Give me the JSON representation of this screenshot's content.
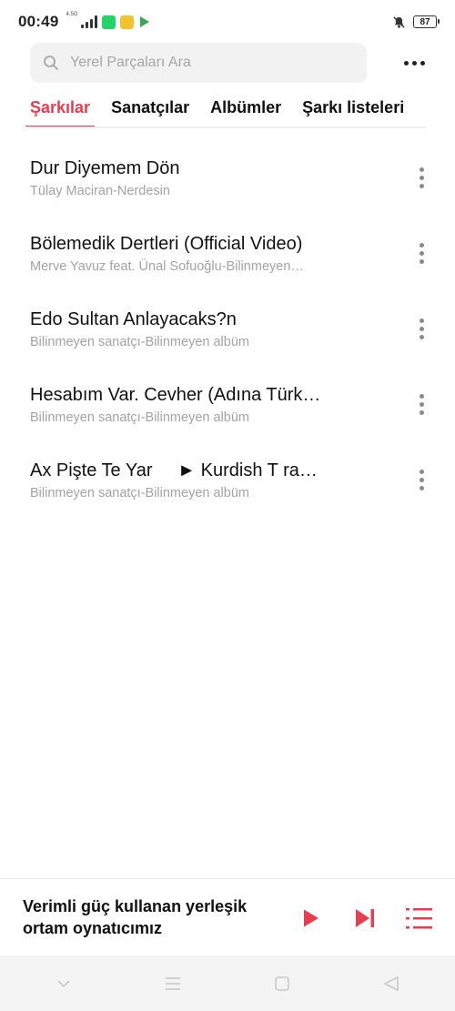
{
  "status": {
    "time": "00:49",
    "network": "4.5G",
    "battery": "87"
  },
  "search": {
    "placeholder": "Yerel Parçaları Ara"
  },
  "tabs": [
    {
      "label": "Şarkılar",
      "active": true
    },
    {
      "label": "Sanatçılar",
      "active": false
    },
    {
      "label": "Albümler",
      "active": false
    },
    {
      "label": "Şarkı listeleri",
      "active": false
    }
  ],
  "songs": [
    {
      "title": "Dur Diyemem Dön",
      "subtitle": "Tülay Maciran-Nerdesin"
    },
    {
      "title": "Bölemedik Dertleri (Official Video)",
      "subtitle": "Merve Yavuz feat. Ünal Sofuoğlu-Bilinmeyen…"
    },
    {
      "title": "Edo Sultan Anlayacaks?n",
      "subtitle": "Bilinmeyen sanatçı-Bilinmeyen albüm"
    },
    {
      "title": "Hesabım Var. Cevher (Adına Türk…",
      "subtitle": "Bilinmeyen sanatçı-Bilinmeyen albüm"
    },
    {
      "title": "Ax Pişte Te Yar     ► Kurdish T ra…",
      "subtitle": "Bilinmeyen sanatçı-Bilinmeyen albüm"
    }
  ],
  "player": {
    "text": "Verimli güç kullanan yerleşik ortam oynatıcımız"
  },
  "colors": {
    "accent": "#e63d4f",
    "secondary_text": "#a3a3a3"
  },
  "icons": {
    "search": "search-icon",
    "more": "more-icon",
    "song_menu": "vertical-dots-icon",
    "play": "play-icon",
    "next": "skip-next-icon",
    "queue": "queue-list-icon"
  }
}
